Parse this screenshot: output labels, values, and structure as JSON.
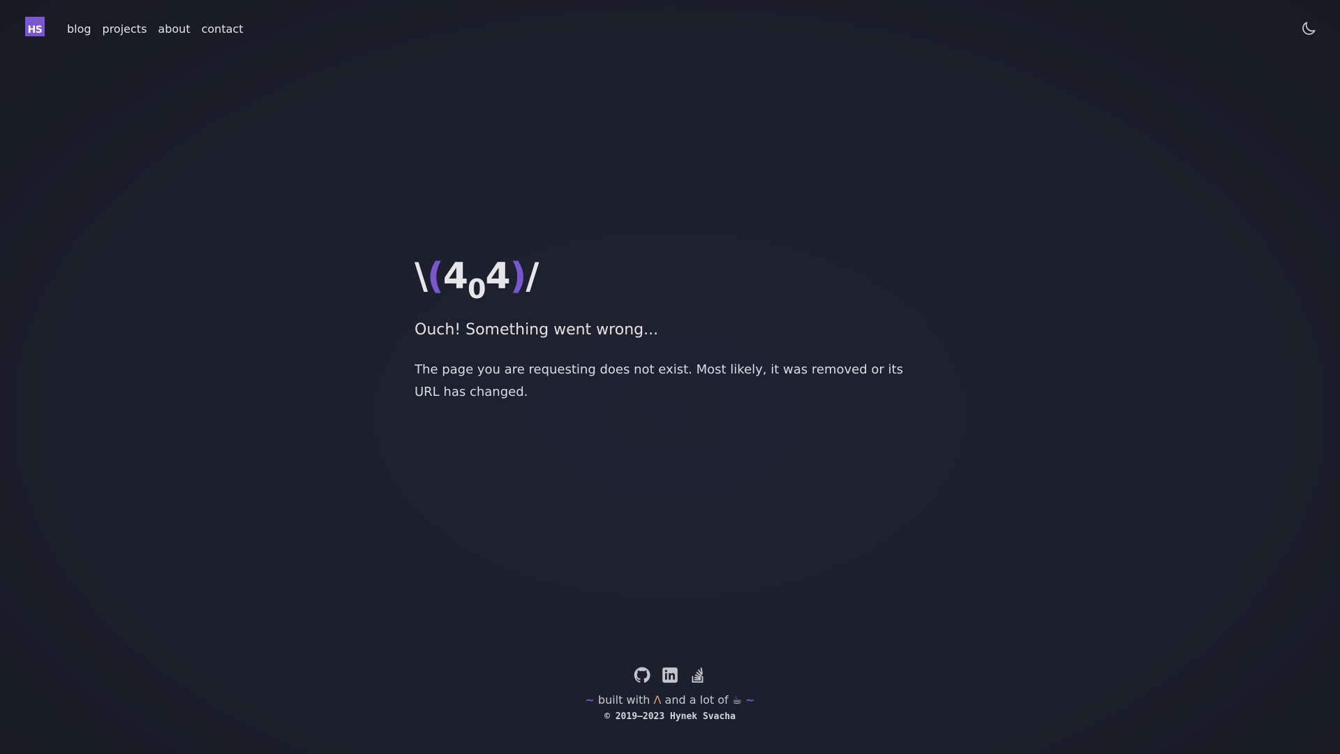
{
  "header": {
    "logo_text": "HS",
    "nav": [
      {
        "label": "blog"
      },
      {
        "label": "projects"
      },
      {
        "label": "about"
      },
      {
        "label": "contact"
      }
    ],
    "theme_toggle_icon": "moon-icon"
  },
  "main": {
    "code_left": "\\",
    "code_paren_open": "(",
    "code_digit_1": "4",
    "code_digit_0": "0",
    "code_digit_2": "4",
    "code_paren_close": ")",
    "code_right": "/",
    "heading": "Ouch! Something went wrong...",
    "message": "The page you are requesting does not exist. Most likely, it was removed or its URL has changed."
  },
  "footer": {
    "social_icons": [
      "github-icon",
      "linkedin-icon",
      "stackoverflow-icon"
    ],
    "built_prefix": "~",
    "built_text_1": "built with",
    "built_glyph": "Ʌ",
    "built_text_2": "and a lot of",
    "built_emoji": "☕",
    "built_suffix": "~",
    "copyright": "© 2019–2023 Hynek Svacha"
  },
  "colors": {
    "accent": "#7a57d1",
    "background": "#1b1f2b",
    "text": "#e6e6ea"
  }
}
